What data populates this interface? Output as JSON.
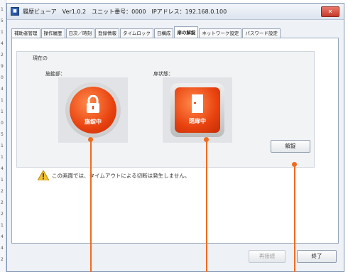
{
  "gutter_digits": [
    "1",
    "5",
    "1",
    "4",
    "2",
    "9",
    "0",
    "4",
    "1",
    "1",
    "0",
    "5",
    "1",
    "1",
    "4",
    "1",
    "2",
    "2",
    "2",
    "1",
    "4",
    "4",
    "2"
  ],
  "window": {
    "app_icon_glyph": "■",
    "title": "履歴ビューア　Ver1.0.2　ユニット番号：0000　IPアドレス：192.168.0.100",
    "close_glyph": "✕"
  },
  "tabs": [
    "補助者管理",
    "操作履歴",
    "日次／時刻",
    "登録情報",
    "タイムロック",
    "日構成",
    "扉の解錠",
    "ネットワーク設定",
    "パスワード設定"
  ],
  "active_tab_index": 6,
  "operation": {
    "group_label": "現在の",
    "lock_label": "施錠部：",
    "lock_state": "施錠中",
    "door_label": "扉状態：",
    "door_state": "閉扉中",
    "unlock_button": "解錠"
  },
  "notice": "この画面では、タイムアウトによる切断は発生しません。",
  "footer": {
    "apply_button": "再接続",
    "close_button": "終了"
  },
  "colors": {
    "accent": "#ef6c1f",
    "indicator": "#e8420f"
  },
  "icons": {
    "lock": "padlock-icon",
    "door": "door-icon",
    "warning": "warning-triangle-icon"
  }
}
